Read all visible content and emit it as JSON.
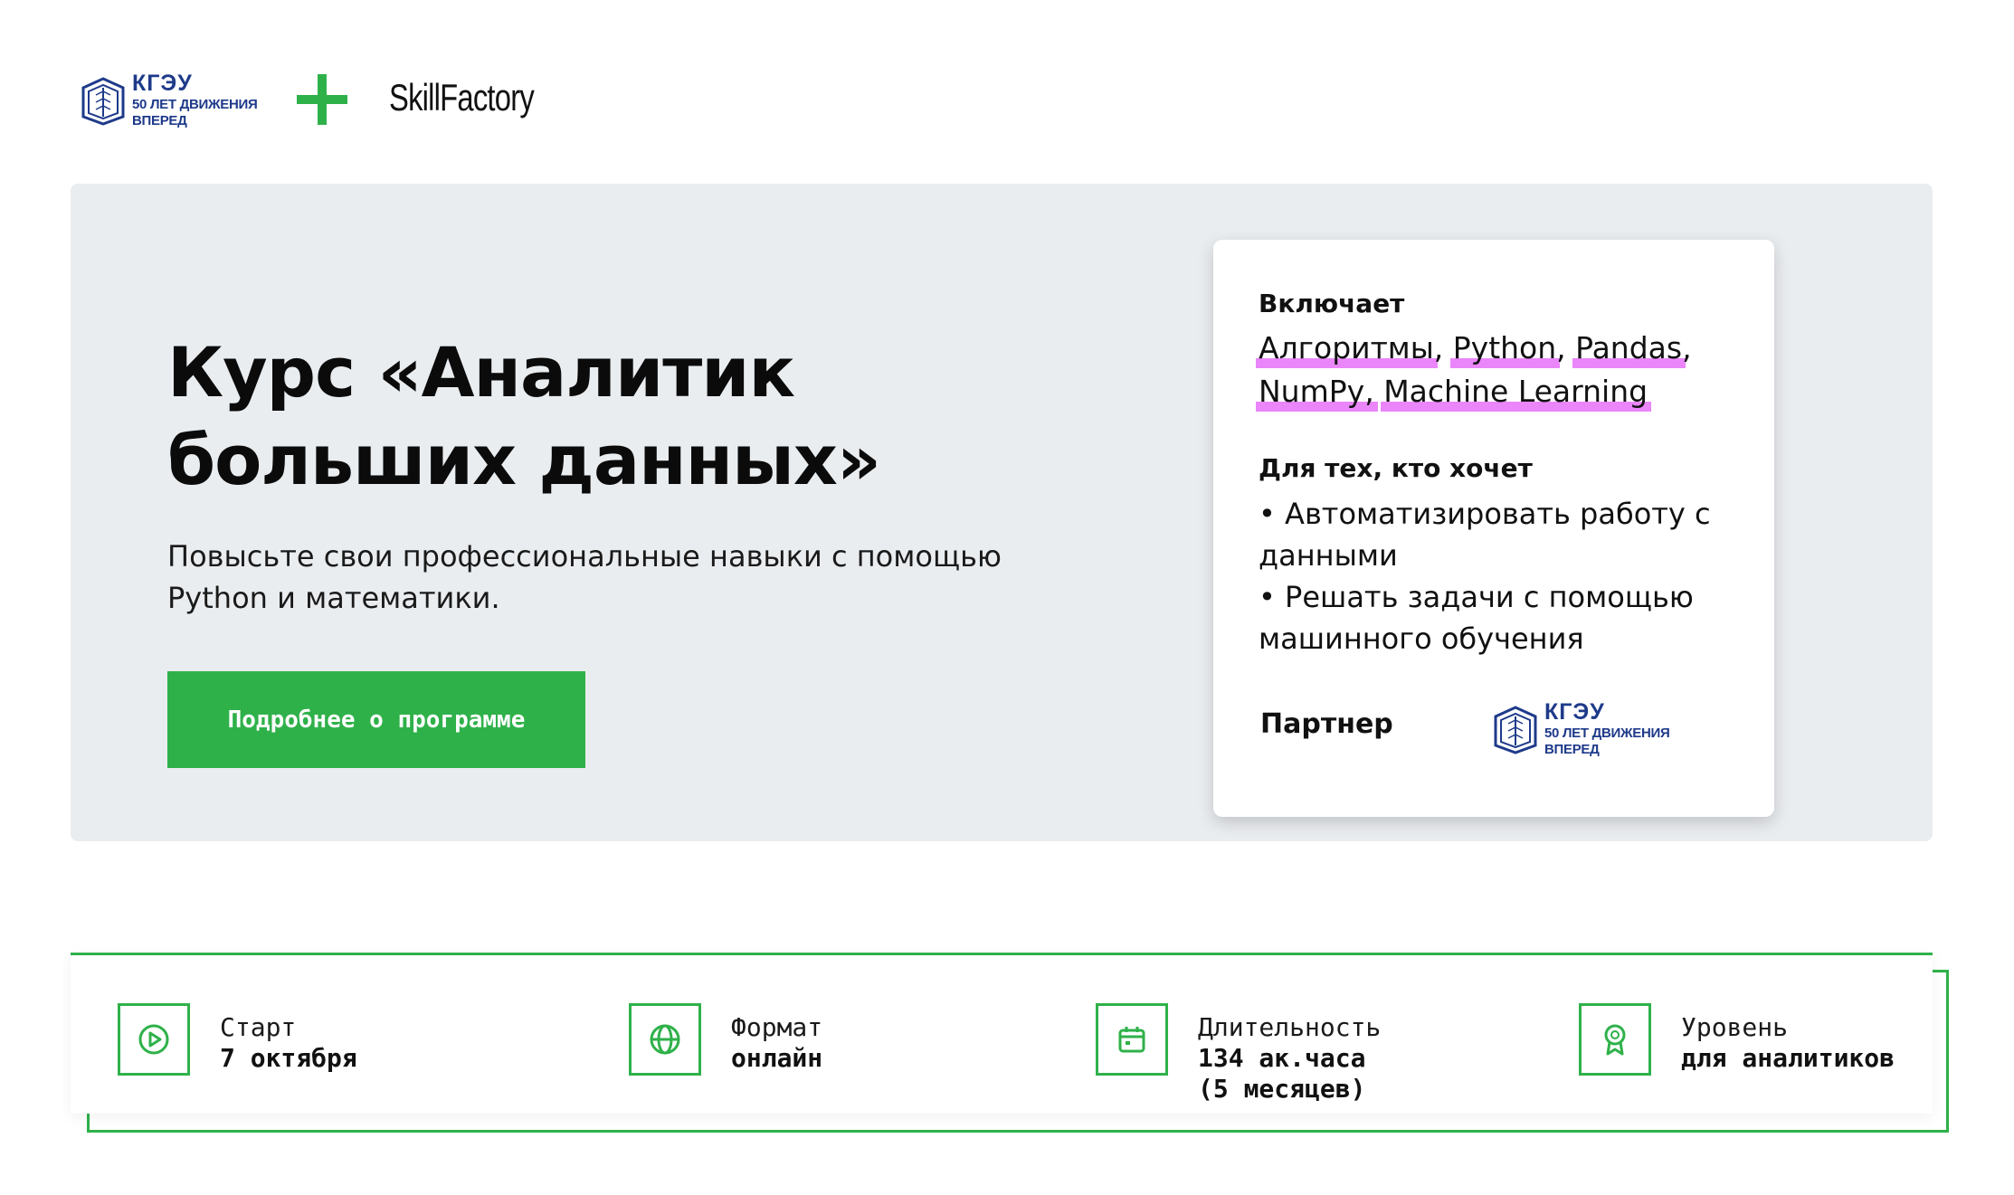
{
  "header": {
    "partner_logo": {
      "name": "КГЭУ",
      "tagline_line1": "50 ЛЕТ ДВИЖЕНИЯ",
      "tagline_line2": "ВПЕРЕД"
    },
    "brand_logo": "SkillFactory",
    "accent_color": "#2fb14a"
  },
  "hero": {
    "title_line1": "Курс «Аналитик",
    "title_line2": "больших данных»",
    "subtitle": "Повысьте свои профессиональные навыки с помощью Python и математики.",
    "cta_label": "Подробнее о программе",
    "background": "#eaedf0"
  },
  "card": {
    "includes_heading": "Включает",
    "tags": [
      "Алгоритмы",
      "Python",
      "Pandas",
      "NumPy",
      "Machine Learning"
    ],
    "separator": ",",
    "audience_heading": "Для тех, кто хочет",
    "audience_items": [
      "• Автоматизировать работу с данными",
      "• Решать задачи с помощью машинного обучения"
    ],
    "partner_label": "Партнер",
    "partner_logo": {
      "name": "КГЭУ",
      "tagline_line1": "50 ЛЕТ ДВИЖЕНИЯ",
      "tagline_line2": "ВПЕРЕД"
    },
    "highlight_color": "#e879f9"
  },
  "stats": [
    {
      "icon": "play-icon",
      "label": "Старт",
      "value": "7 октября",
      "value2": ""
    },
    {
      "icon": "globe-icon",
      "label": "Формат",
      "value": "онлайн",
      "value2": ""
    },
    {
      "icon": "calendar-icon",
      "label": "Длительность",
      "value": "134 ак.часа",
      "value2": "(5 месяцев)"
    },
    {
      "icon": "award-icon",
      "label": "Уровень",
      "value": "для аналитиков",
      "value2": ""
    }
  ]
}
